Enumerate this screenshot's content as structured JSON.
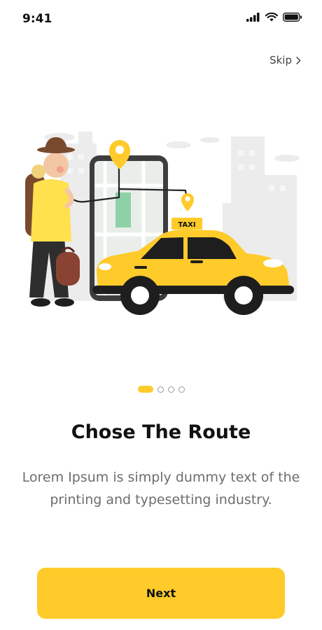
{
  "status_bar": {
    "time": "9:41"
  },
  "header": {
    "skip_label": "Skip",
    "skip_icon": "chevron-right-icon"
  },
  "illustration": {
    "taxi_sign": "TAXI"
  },
  "pagination": {
    "total": 4,
    "active_index": 0
  },
  "content": {
    "title": "Chose The Route",
    "description": "Lorem Ipsum is simply dummy text of the printing and typesetting industry."
  },
  "footer": {
    "next_label": "Next"
  },
  "colors": {
    "accent": "#FFCB2B",
    "background": "#FFFFFF",
    "title": "#111111",
    "body_text": "#6D6D6D"
  }
}
